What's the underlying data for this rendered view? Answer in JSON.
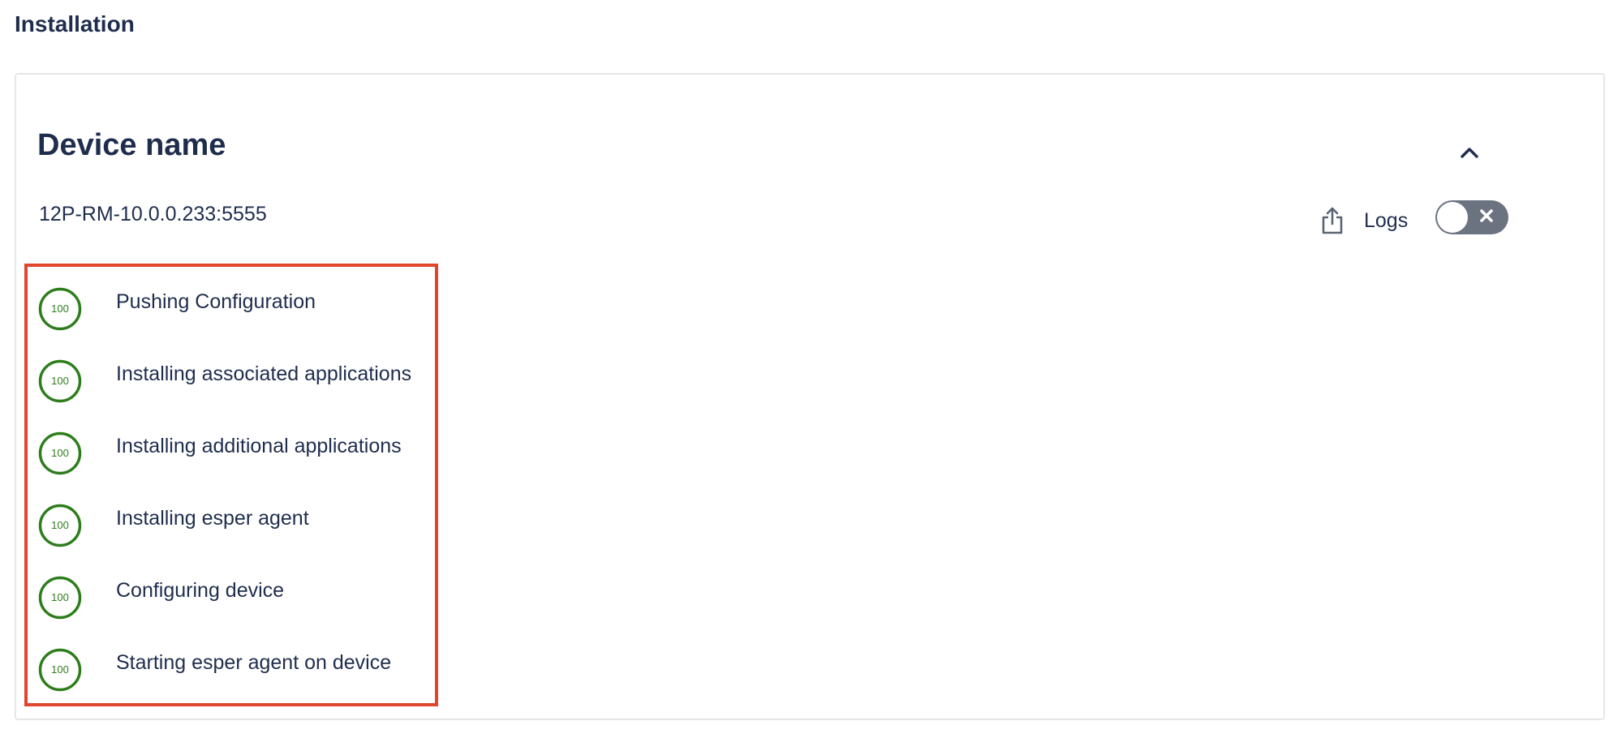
{
  "page": {
    "title": "Installation"
  },
  "device": {
    "title": "Device name",
    "id": "12P-RM-10.0.0.233:5555"
  },
  "logs": {
    "label": "Logs",
    "toggle_state": "off"
  },
  "colors": {
    "text": "#1f2d4d",
    "success": "#2e7d1c",
    "highlight": "#e1452c",
    "toggle_bg": "#6b7380"
  },
  "icons": {
    "collapse": "chevron-up-icon",
    "share": "share-icon",
    "toggle_off": "close-icon"
  },
  "steps": [
    {
      "progress": "100",
      "label": "Pushing Configuration"
    },
    {
      "progress": "100",
      "label": "Installing associated applications"
    },
    {
      "progress": "100",
      "label": "Installing additional applications"
    },
    {
      "progress": "100",
      "label": "Installing esper agent"
    },
    {
      "progress": "100",
      "label": "Configuring device"
    },
    {
      "progress": "100",
      "label": "Starting esper agent on device"
    }
  ]
}
